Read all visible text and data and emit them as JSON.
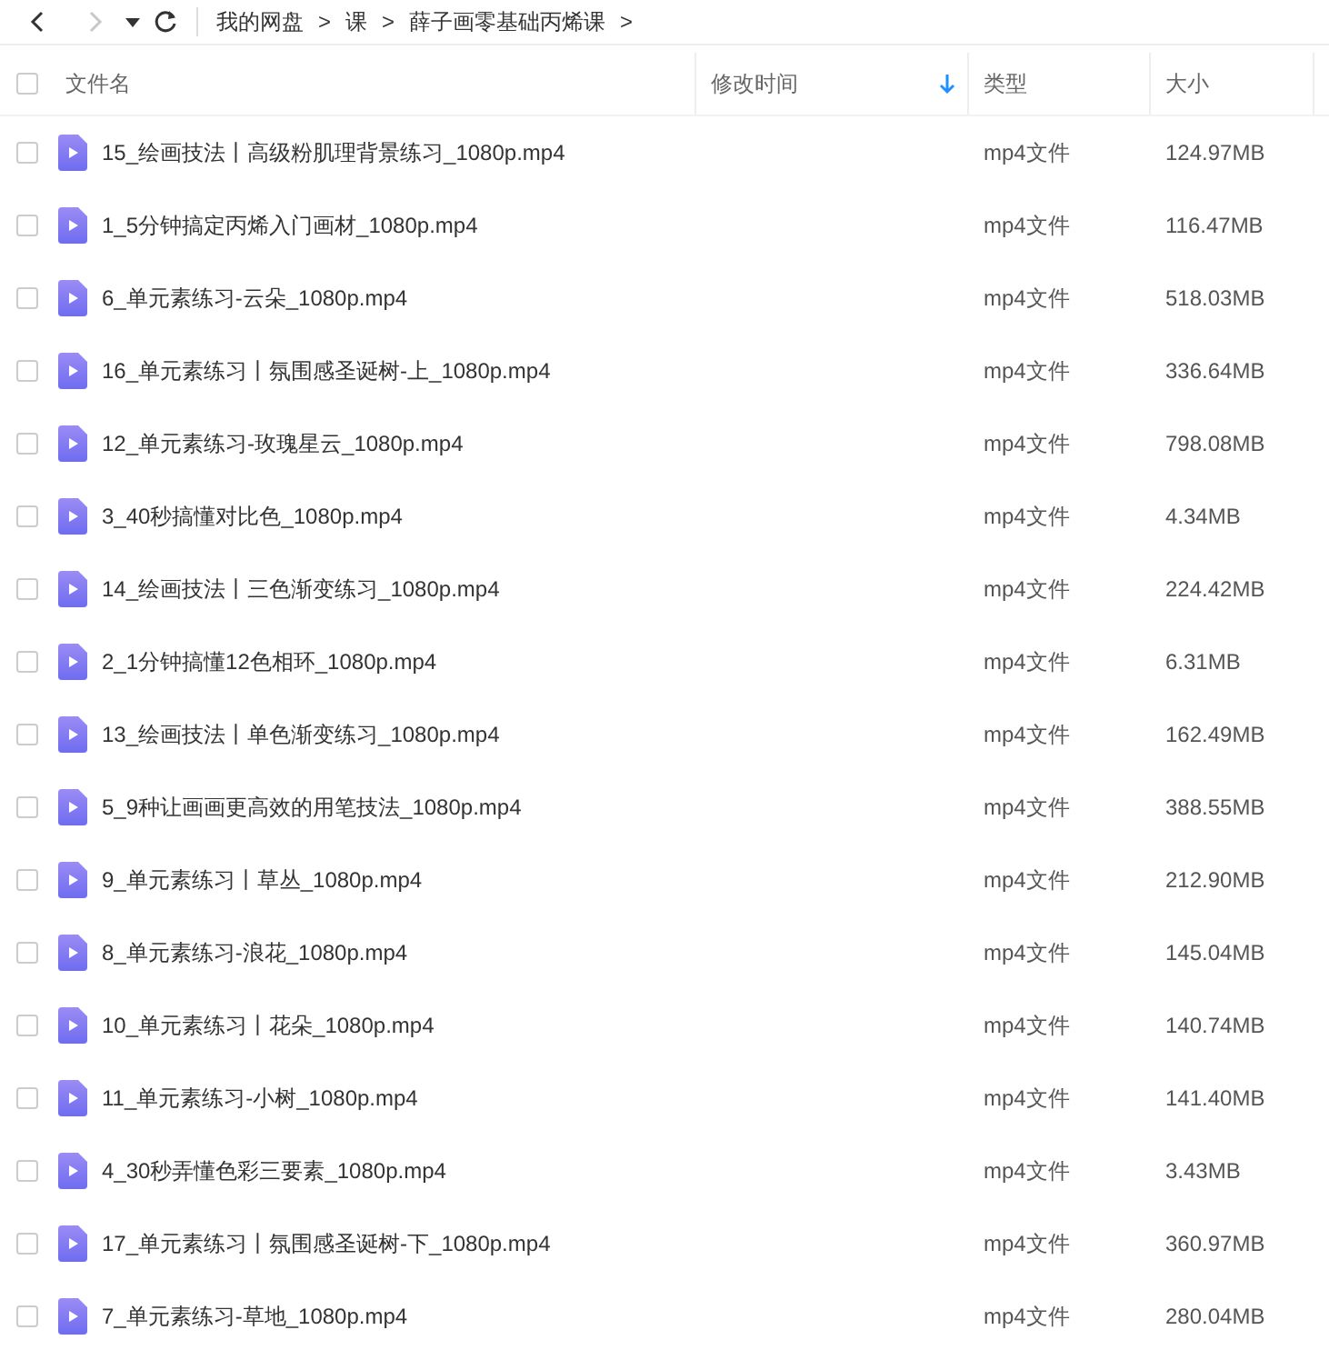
{
  "toolbar": {
    "back": {
      "disabled": false
    },
    "forward": {
      "disabled": true
    },
    "breadcrumb": [
      {
        "label": "我的网盘",
        "separator": ">"
      },
      {
        "label": "课",
        "separator": ">"
      },
      {
        "label": "薛子画零基础丙烯课",
        "separator": ">"
      }
    ]
  },
  "table": {
    "select_all": {
      "checked": false
    },
    "columns": [
      {
        "label": "文件名",
        "sorted": false
      },
      {
        "label": "修改时间",
        "sorted": true
      },
      {
        "label": "类型",
        "sorted": false
      },
      {
        "label": "大小",
        "sorted": false
      }
    ],
    "rows": [
      {
        "name": "15_绘画技法丨高级粉肌理背景练习_1080p.mp4",
        "type": "mp4文件",
        "size": "124.97MB",
        "checked": false
      },
      {
        "name": "1_5分钟搞定丙烯入门画材_1080p.mp4",
        "type": "mp4文件",
        "size": "116.47MB",
        "checked": false
      },
      {
        "name": "6_单元素练习-云朵_1080p.mp4",
        "type": "mp4文件",
        "size": "518.03MB",
        "checked": false
      },
      {
        "name": "16_单元素练习丨氛围感圣诞树-上_1080p.mp4",
        "type": "mp4文件",
        "size": "336.64MB",
        "checked": false
      },
      {
        "name": "12_单元素练习-玫瑰星云_1080p.mp4",
        "type": "mp4文件",
        "size": "798.08MB",
        "checked": false
      },
      {
        "name": "3_40秒搞懂对比色_1080p.mp4",
        "type": "mp4文件",
        "size": "4.34MB",
        "checked": false
      },
      {
        "name": "14_绘画技法丨三色渐变练习_1080p.mp4",
        "type": "mp4文件",
        "size": "224.42MB",
        "checked": false
      },
      {
        "name": "2_1分钟搞懂12色相环_1080p.mp4",
        "type": "mp4文件",
        "size": "6.31MB",
        "checked": false
      },
      {
        "name": "13_绘画技法丨单色渐变练习_1080p.mp4",
        "type": "mp4文件",
        "size": "162.49MB",
        "checked": false
      },
      {
        "name": "5_9种让画画更高效的用笔技法_1080p.mp4",
        "type": "mp4文件",
        "size": "388.55MB",
        "checked": false
      },
      {
        "name": "9_单元素练习丨草丛_1080p.mp4",
        "type": "mp4文件",
        "size": "212.90MB",
        "checked": false
      },
      {
        "name": "8_单元素练习-浪花_1080p.mp4",
        "type": "mp4文件",
        "size": "145.04MB",
        "checked": false
      },
      {
        "name": "10_单元素练习丨花朵_1080p.mp4",
        "type": "mp4文件",
        "size": "140.74MB",
        "checked": false
      },
      {
        "name": "11_单元素练习-小树_1080p.mp4",
        "type": "mp4文件",
        "size": "141.40MB",
        "checked": false
      },
      {
        "name": "4_30秒弄懂色彩三要素_1080p.mp4",
        "type": "mp4文件",
        "size": "3.43MB",
        "checked": false
      },
      {
        "name": "17_单元素练习丨氛围感圣诞树-下_1080p.mp4",
        "type": "mp4文件",
        "size": "360.97MB",
        "checked": false
      },
      {
        "name": "7_单元素练习-草地_1080p.mp4",
        "type": "mp4文件",
        "size": "280.04MB",
        "checked": false
      }
    ]
  }
}
